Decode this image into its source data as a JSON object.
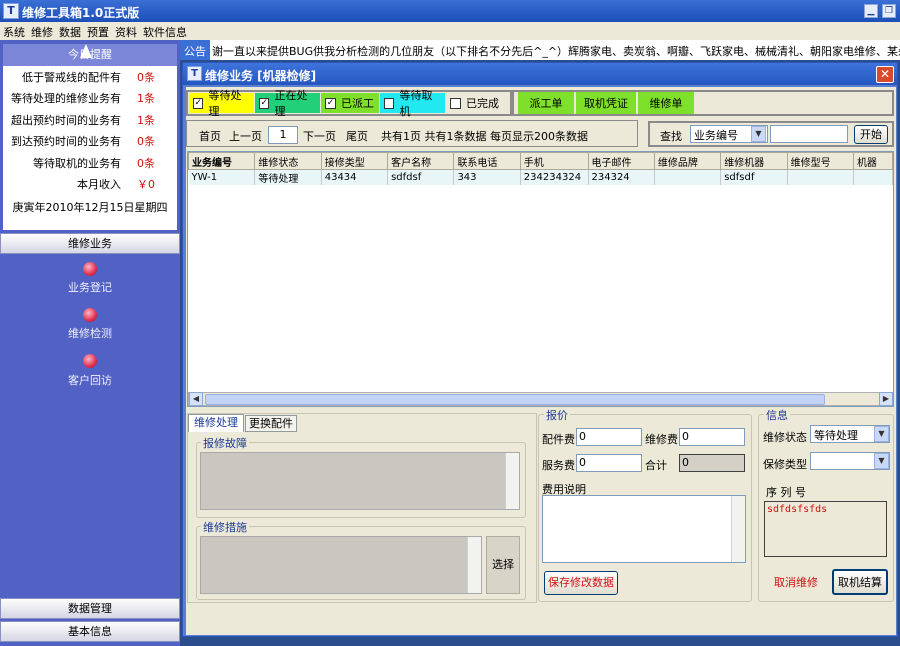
{
  "app": {
    "title": "维修工具箱1.0正式版"
  },
  "menu": [
    "系统",
    "维修",
    "数据",
    "预置",
    "资料",
    "软件信息"
  ],
  "notice": {
    "label": "公告",
    "text": "谢一直以来提供BUG供我分析检测的几位朋友（以下排名不分先后^_^）辉腾家电、卖炭翁、啊瓣、飞跃家电、械械清礼、朝阳家电维修、某杀毒软"
  },
  "alerts": {
    "header": "今日提醒",
    "rows": [
      {
        "label": "低于警戒线的配件有",
        "value": "0条"
      },
      {
        "label": "等待处理的维修业务有",
        "value": "1条"
      },
      {
        "label": "超出预约时间的业务有",
        "value": "1条"
      },
      {
        "label": "到达预约时间的业务有",
        "value": "0条"
      },
      {
        "label": "等待取机的业务有",
        "value": "0条"
      },
      {
        "label": "本月收入",
        "value": "￥0"
      }
    ],
    "date": "庚寅年2010年12月15日星期四"
  },
  "sidebar": {
    "section": "维修业务",
    "items": [
      "业务登记",
      "维修检测",
      "客户回访"
    ],
    "bottom": [
      "数据管理",
      "基本信息"
    ]
  },
  "dialog": {
    "title": "维修业务 [机器检修]",
    "filters": [
      {
        "label": "等待处理",
        "checked": true,
        "color": "#ffff00"
      },
      {
        "label": "正在处理",
        "checked": true,
        "color": "#22d07a"
      },
      {
        "label": "已派工",
        "checked": true,
        "color": "#7ee02a"
      },
      {
        "label": "等待取机",
        "checked": false,
        "color": "#22e8f0"
      },
      {
        "label": "已完成",
        "checked": false,
        "color": "#ece9d8"
      }
    ],
    "actions": [
      "派工单",
      "取机凭证",
      "维修单"
    ],
    "paging": {
      "first": "首页",
      "prev": "上一页",
      "page": "1",
      "next": "下一页",
      "last": "尾页",
      "info": "共有1页 共有1条数据 每页显示200条数据"
    },
    "search": {
      "label": "查找",
      "field": "业务编号",
      "button": "开始"
    },
    "grid": {
      "columns": [
        "业务编号",
        "维修状态",
        "接修类型",
        "客户名称",
        "联系电话",
        "手机",
        "电子邮件",
        "维修品牌",
        "维修机器",
        "维修型号",
        "机器"
      ],
      "rows": [
        [
          "YW-1",
          "等待处理",
          "43434",
          "sdfdsf",
          "343",
          "234234324",
          "234324",
          "",
          "sdfsdf",
          "",
          ""
        ]
      ]
    },
    "tabs": [
      "维修处理",
      "更换配件"
    ],
    "fault_label": "报修故障",
    "measure_label": "维修措施",
    "choose_button": "选择",
    "quote": {
      "title": "报价",
      "parts_fee_label": "配件费",
      "parts_fee": "0",
      "repair_fee_label": "维修费",
      "repair_fee": "0",
      "service_fee_label": "服务费",
      "service_fee": "0",
      "total_label": "合计",
      "total": "0",
      "note_label": "费用说明",
      "save_button": "保存修改数据"
    },
    "info": {
      "title": "信息",
      "status_label": "维修状态",
      "status": "等待处理",
      "warranty_label": "保修类型",
      "warranty": "",
      "serial_label": "序 列 号",
      "serial": "sdfdsfsfds",
      "cancel_button": "取消维修",
      "checkout_button": "取机结算"
    }
  }
}
